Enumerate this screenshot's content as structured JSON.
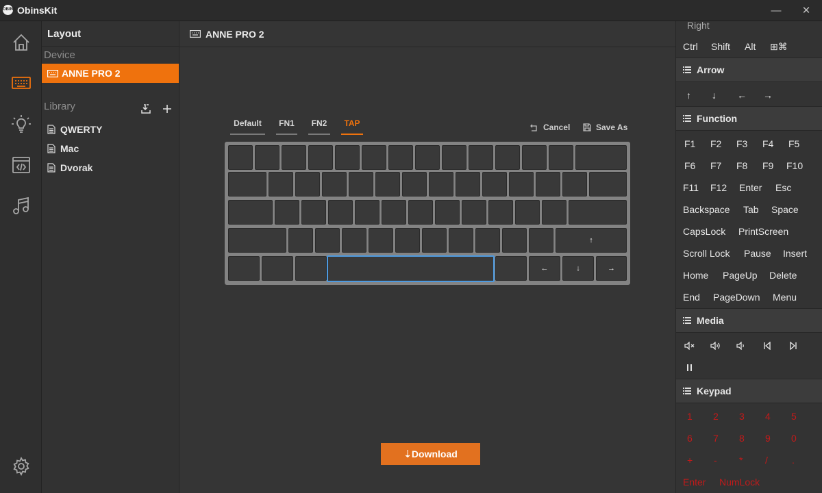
{
  "window": {
    "title": "ObinsKit",
    "logo_text": "OBINS",
    "minimize_symbol": "—",
    "close_symbol": "✕"
  },
  "nav": [
    {
      "icon": "home-icon"
    },
    {
      "icon": "keyboard-icon"
    },
    {
      "icon": "lightbulb-icon"
    },
    {
      "icon": "code-icon"
    },
    {
      "icon": "music-icon"
    },
    {
      "icon": "gear-icon"
    }
  ],
  "layout_panel": {
    "title": "Layout",
    "device_label": "Device",
    "device_name": "ANNE PRO 2",
    "library_label": "Library",
    "library_items": [
      "QWERTY",
      "Mac",
      "Dvorak"
    ]
  },
  "main": {
    "device_title": "ANNE PRO 2",
    "tabs": [
      "Default",
      "FN1",
      "FN2",
      "TAP"
    ],
    "active_tab": "TAP",
    "cancel_label": "Cancel",
    "save_as_label": "Save As",
    "arrow_keys": {
      "up": "↑",
      "left": "←",
      "down": "↓",
      "right": "→"
    },
    "download_label": "⇣Download"
  },
  "right_panel": {
    "partial_heading": "Right",
    "modifier_keys": [
      "Ctrl",
      "Shift",
      "Alt",
      "⊞⌘"
    ],
    "sections": {
      "arrow": "Arrow",
      "function": "Function",
      "media": "Media",
      "keypad": "Keypad"
    },
    "arrow_keys": [
      "↑",
      "↓",
      "←",
      "→"
    ],
    "function_keys": [
      "F1",
      "F2",
      "F3",
      "F4",
      "F5",
      "F6",
      "F7",
      "F8",
      "F9",
      "F10",
      "F11",
      "F12",
      "Enter",
      "Esc",
      "Backspace",
      "Tab",
      "Space",
      "CapsLock",
      "PrintScreen",
      "Scroll Lock",
      "Pause",
      "Insert",
      "Home",
      "PageUp",
      "Delete",
      "End",
      "PageDown",
      "Menu"
    ],
    "media_keys": [
      "mute-icon",
      "volume-up-icon",
      "volume-down-icon",
      "previous-track-icon",
      "next-track-icon",
      "play-pause-icon"
    ],
    "keypad_keys": [
      "1",
      "2",
      "3",
      "4",
      "5",
      "6",
      "7",
      "8",
      "9",
      "0",
      "+",
      "-",
      "*",
      "/",
      ".",
      "Enter",
      "NumLock"
    ]
  },
  "colors": {
    "accent": "#ef720d",
    "selected_key_border": "#4d9ae0",
    "keypad_text": "#c31a1a"
  }
}
